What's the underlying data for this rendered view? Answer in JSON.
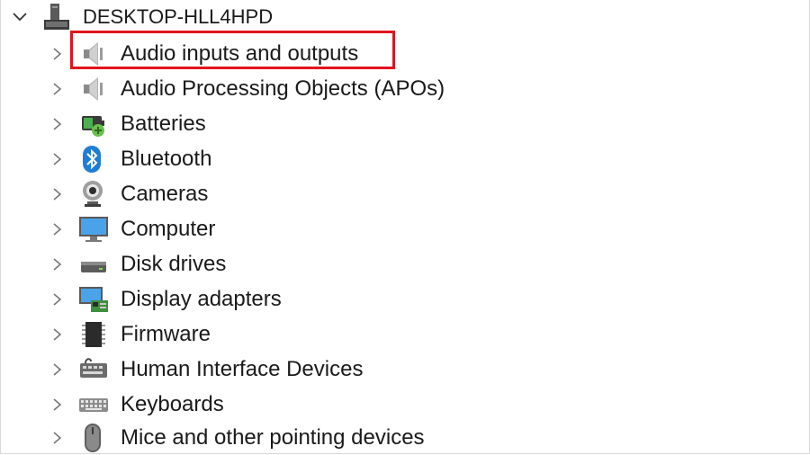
{
  "root": {
    "label": "DESKTOP-HLL4HPD",
    "icon": "computer-tower-icon",
    "expanded": true
  },
  "categories": [
    {
      "label": "Audio inputs and outputs",
      "icon": "speaker-icon"
    },
    {
      "label": "Audio Processing Objects (APOs)",
      "icon": "speaker-icon"
    },
    {
      "label": "Batteries",
      "icon": "battery-icon"
    },
    {
      "label": "Bluetooth",
      "icon": "bluetooth-icon"
    },
    {
      "label": "Cameras",
      "icon": "webcam-icon"
    },
    {
      "label": "Computer",
      "icon": "monitor-icon"
    },
    {
      "label": "Disk drives",
      "icon": "disk-drive-icon"
    },
    {
      "label": "Display adapters",
      "icon": "display-adapter-icon"
    },
    {
      "label": "Firmware",
      "icon": "chip-icon"
    },
    {
      "label": "Human Interface Devices",
      "icon": "hid-icon"
    },
    {
      "label": "Keyboards",
      "icon": "keyboard-icon"
    },
    {
      "label": "Mice and other pointing devices",
      "icon": "mouse-icon"
    }
  ],
  "highlight": {
    "target": "Audio inputs and outputs",
    "color": "#e0141e"
  }
}
